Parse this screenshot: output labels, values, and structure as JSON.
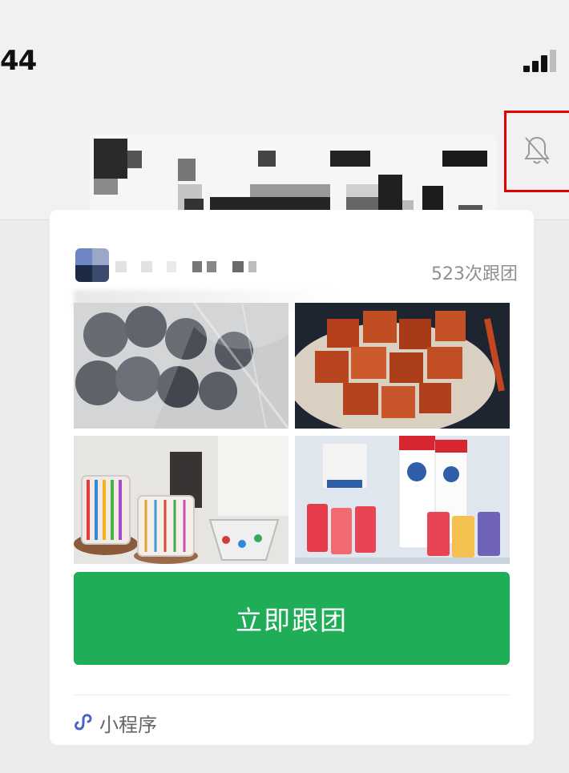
{
  "status_bar": {
    "time": "44"
  },
  "card": {
    "follow_count": "523次跟团",
    "join_button_label": "立即跟团",
    "mini_program_label": "小程序",
    "images": [
      "dark-round-snacks-in-bag",
      "spicy-cubed-snacks-on-plate",
      "striped-glass-cups",
      "yogurt-drink-bottles"
    ]
  },
  "icons": {
    "mute": "bell-off-icon",
    "mini_program": "mini-program-icon",
    "signal": "signal-icon"
  },
  "colors": {
    "button": "#1fad58",
    "highlight": "#e30000"
  }
}
